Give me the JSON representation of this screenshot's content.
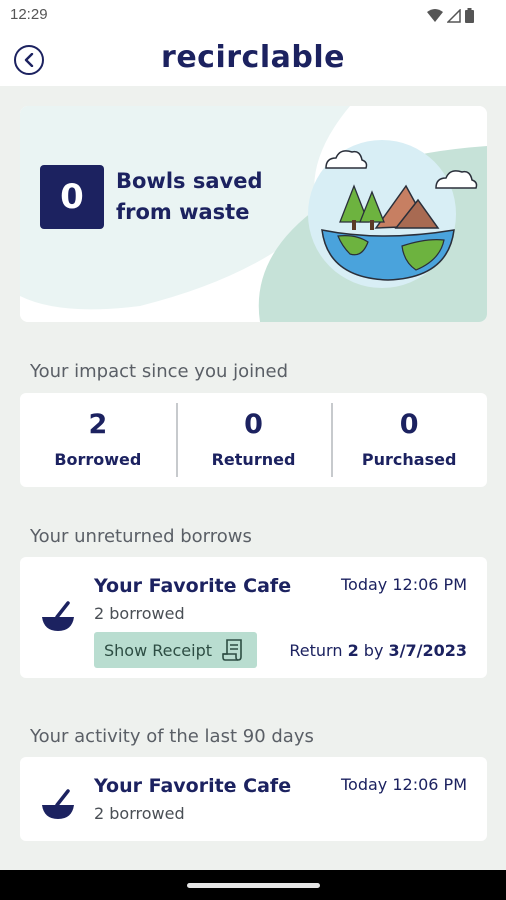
{
  "status_bar": {
    "time": "12:29"
  },
  "header": {
    "logo": "recirclable"
  },
  "hero": {
    "count": "0",
    "label_line1": "Bowls saved",
    "label_line2": "from waste"
  },
  "impact": {
    "title": "Your impact since you joined",
    "stats": [
      {
        "value": "2",
        "label": "Borrowed"
      },
      {
        "value": "0",
        "label": "Returned"
      },
      {
        "value": "0",
        "label": "Purchased"
      }
    ]
  },
  "unreturned": {
    "title": "Your unreturned borrows",
    "items": [
      {
        "cafe": "Your Favorite Cafe",
        "count_text": "2 borrowed",
        "time": "Today 12:06 PM",
        "receipt_label": "Show Receipt",
        "return_prefix": "Return",
        "return_qty": "2",
        "return_by": "by",
        "return_date": "3/7/2023"
      }
    ]
  },
  "activity": {
    "title": "Your activity of the last 90 days",
    "items": [
      {
        "cafe": "Your Favorite Cafe",
        "count_text": "2 borrowed",
        "time": "Today 12:06 PM"
      }
    ]
  },
  "colors": {
    "navy": "#1c2260",
    "mint": "#b9ddd0",
    "background": "#eef1ee"
  }
}
